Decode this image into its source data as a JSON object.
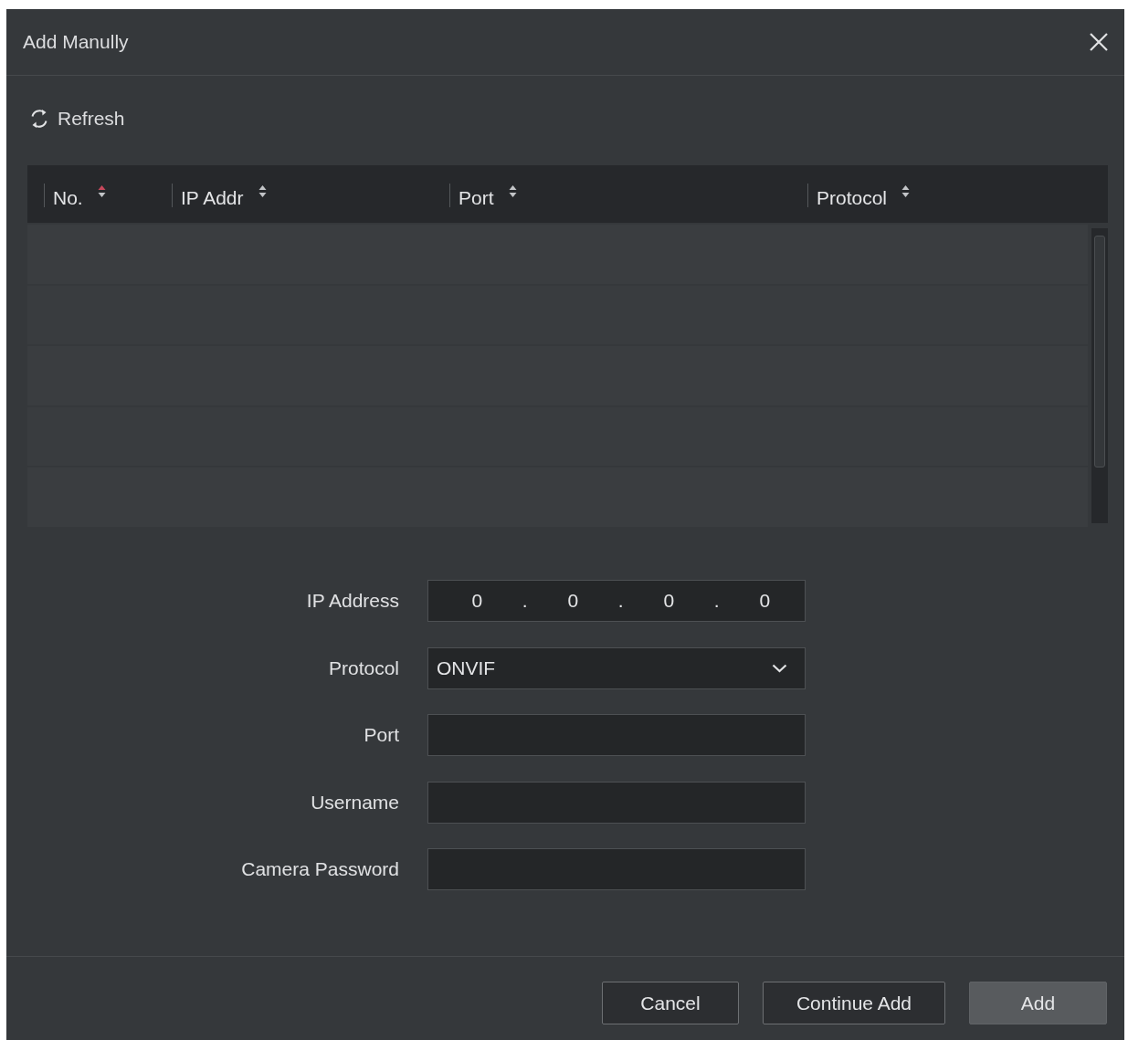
{
  "dialog": {
    "title": "Add Manully"
  },
  "toolbar": {
    "refresh": {
      "label": "Refresh"
    }
  },
  "table": {
    "columns": [
      {
        "label": "No.",
        "sorted": true
      },
      {
        "label": "IP Addr",
        "sorted": false
      },
      {
        "label": "Port",
        "sorted": false
      },
      {
        "label": "Protocol",
        "sorted": false
      }
    ]
  },
  "form": {
    "fields": [
      {
        "kind": "ip",
        "label": "IP Address",
        "octets": [
          "0",
          "0",
          "0",
          "0"
        ],
        "separators": [
          ".",
          ".",
          "."
        ]
      },
      {
        "kind": "select",
        "label": "Protocol",
        "value": "ONVIF"
      },
      {
        "kind": "text",
        "label": "Port"
      },
      {
        "kind": "text",
        "label": "Username"
      },
      {
        "kind": "text",
        "label": "Camera Password"
      }
    ]
  },
  "footer": {
    "buttons": [
      {
        "label": "Cancel",
        "kind": "secondary"
      },
      {
        "label": "Continue Add",
        "kind": "secondary"
      },
      {
        "label": "Add",
        "kind": "primary"
      }
    ]
  }
}
